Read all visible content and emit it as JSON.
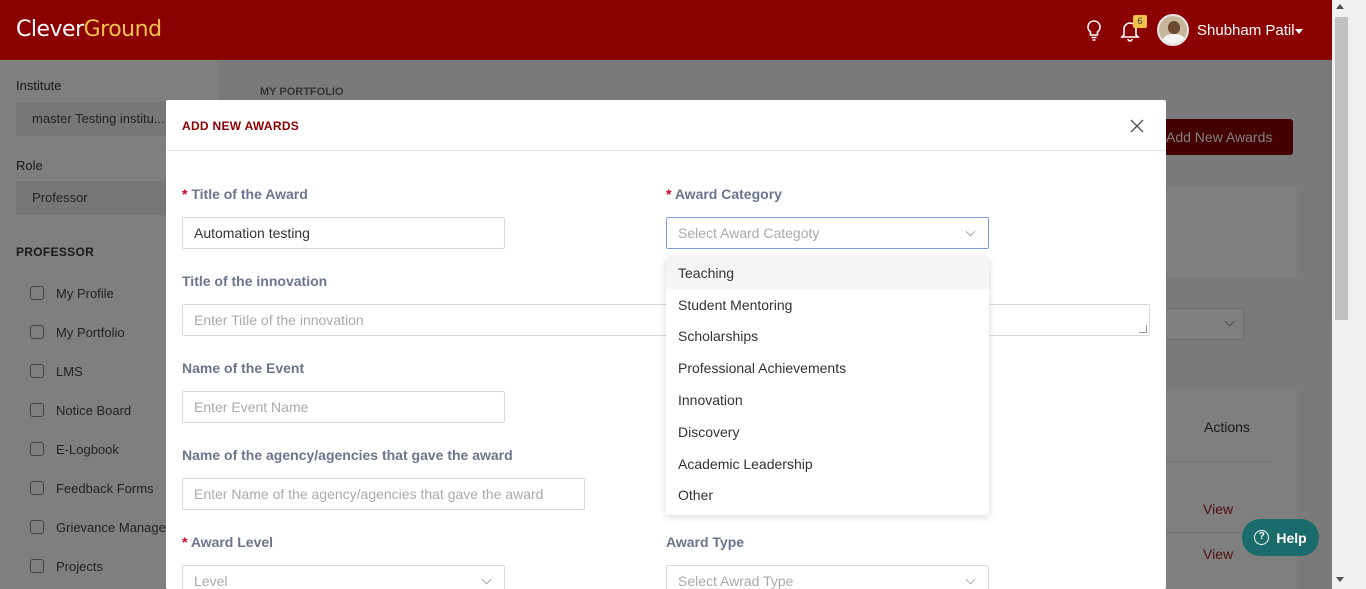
{
  "header": {
    "logo_part1": "Clever",
    "logo_part2": "Ground",
    "notification_count": "6",
    "user_name": "Shubham Patil"
  },
  "sidebar": {
    "institute_label": "Institute",
    "institute_value": "master Testing institu...",
    "role_label": "Role",
    "role_value": "Professor",
    "section_title": "PROFESSOR",
    "items": [
      {
        "label": "My Profile",
        "icon": "user-icon"
      },
      {
        "label": "My Portfolio",
        "icon": "trophy-icon"
      },
      {
        "label": "LMS",
        "icon": "chart-line-icon"
      },
      {
        "label": "Notice Board",
        "icon": "calendar-icon"
      },
      {
        "label": "E-Logbook",
        "icon": "book-icon"
      },
      {
        "label": "Feedback Forms",
        "icon": "book-icon"
      },
      {
        "label": "Grievance Manage",
        "icon": "user-icon"
      },
      {
        "label": "Projects",
        "icon": "book-icon"
      }
    ]
  },
  "page": {
    "breadcrumb": "MY PORTFOLIO",
    "add_button": "Add New Awards",
    "actions_header": "Actions",
    "row_actions": [
      "View",
      "View"
    ]
  },
  "modal": {
    "title": "ADD NEW AWARDS",
    "close_label": "X",
    "fields": {
      "award_title": {
        "label": "Title of the Award",
        "required": true,
        "value": "Automation testing"
      },
      "award_category": {
        "label": "Award Category",
        "required": true,
        "placeholder": "Select Award Categoty"
      },
      "innovation_title": {
        "label": "Title of the innovation",
        "placeholder": "Enter Title of the innovation"
      },
      "event_name": {
        "label": "Name of the Event",
        "placeholder": "Enter Event Name"
      },
      "agency": {
        "label": "Name of the agency/agencies that gave the award",
        "placeholder": "Enter Name of the agency/agencies that gave the award"
      },
      "award_level": {
        "label": "Award Level",
        "required": true,
        "placeholder": "Level"
      },
      "award_type": {
        "label": "Award Type",
        "placeholder": "Select Awrad Type"
      }
    },
    "category_options": [
      "Teaching",
      "Student Mentoring",
      "Scholarships",
      "Professional Achievements",
      "Innovation",
      "Discovery",
      "Academic Leadership",
      "Other"
    ]
  },
  "help": {
    "label": "Help"
  },
  "colors": {
    "brand": "#8b0000",
    "accent": "#f0c14b",
    "help": "#1a6b6b"
  }
}
